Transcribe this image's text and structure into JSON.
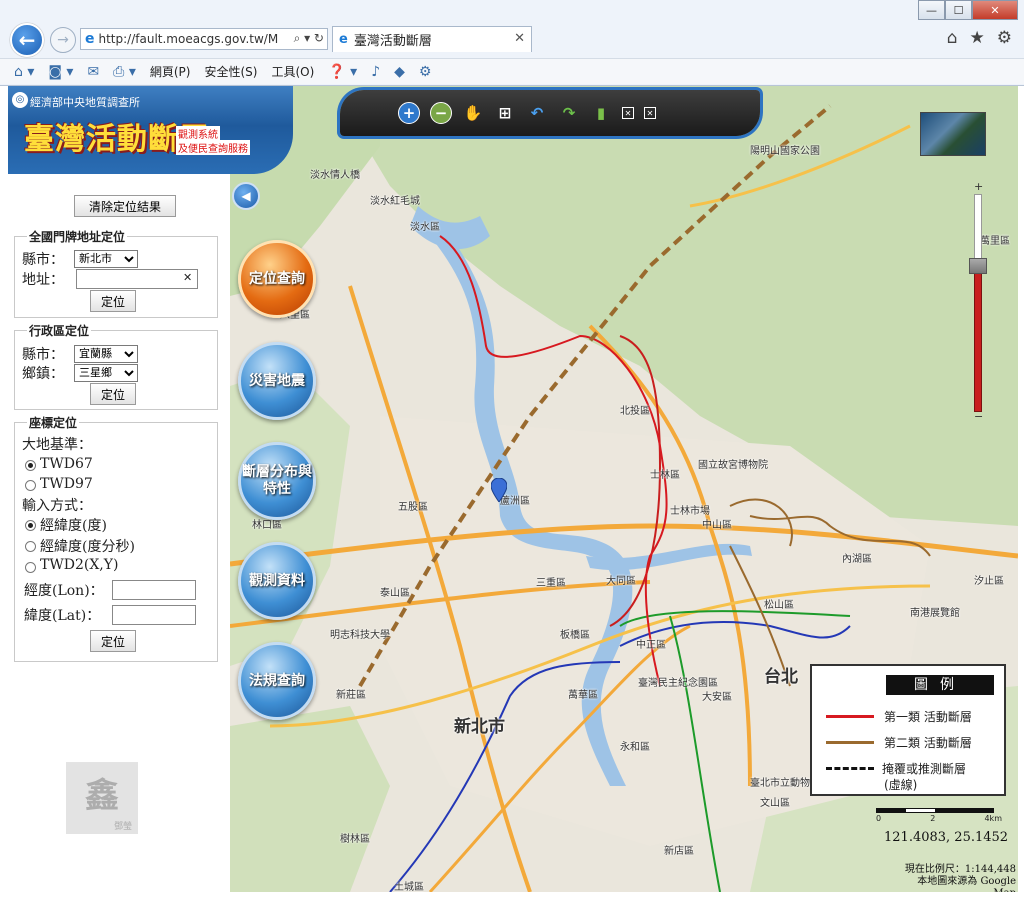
{
  "browser": {
    "url": "http://fault.moeacgs.gov.tw/M",
    "tab_title": "臺灣活動斷層",
    "menu": [
      "網頁(P)",
      "安全性(S)",
      "工具(O)"
    ],
    "titlebar": {
      "min": "—",
      "max": "☐",
      "close": "✕"
    }
  },
  "banner": {
    "org": "經濟部中央地質調查所",
    "title": "臺灣活動斷層",
    "sub1": "觀測系統",
    "sub2": "及便民查詢服務"
  },
  "panel": {
    "clear_label": "清除定位結果",
    "address_section": {
      "legend": "全國門牌地址定位",
      "county_label": "縣市：",
      "county_value": "新北市",
      "address_label": "地址：",
      "address_value": "",
      "locate_label": "定位"
    },
    "admin_section": {
      "legend": "行政區定位",
      "county_label": "縣市：",
      "county_value": "宜蘭縣",
      "town_label": "鄉鎮：",
      "town_value": "三星鄉",
      "locate_label": "定位"
    },
    "coord_section": {
      "legend": "座標定位",
      "datum_label": "大地基準：",
      "datum_options": [
        "TWD67",
        "TWD97"
      ],
      "input_label": "輸入方式：",
      "input_options": [
        "經緯度(度)",
        "經緯度(度分秒)",
        "TWD2(X,Y)"
      ],
      "lon_label": "經度(Lon)：",
      "lat_label": "緯度(Lat)：",
      "locate_label": "定位"
    },
    "seal_text": "鑫",
    "seal_sub": "鄧瑩"
  },
  "map": {
    "side_buttons": [
      "定位查詢",
      "災害地震",
      "斷層分布與特性",
      "觀測資料",
      "法規查詢"
    ],
    "legend": {
      "title": "圖例",
      "items": [
        {
          "label": "第一類 活動斷層",
          "color": "#d71920"
        },
        {
          "label": "第二類 活動斷層",
          "color": "#9a6a2e"
        },
        {
          "label": "掩覆或推測斷層",
          "sub": "(虛線)"
        }
      ]
    },
    "scale_ticks": [
      "0",
      "2",
      "4km"
    ],
    "coords": "121.4083, 25.1452",
    "scale_text": "現在比例尺：1:144,448",
    "source_text": "本地圖來源為 Google Map",
    "labels": [
      {
        "text": "淡水情人橋"
      },
      {
        "text": "淡水紅毛城"
      },
      {
        "text": "淡水區"
      },
      {
        "text": "八里區"
      },
      {
        "text": "北投區"
      },
      {
        "text": "士林區"
      },
      {
        "text": "國立故宮博物院"
      },
      {
        "text": "士林市場"
      },
      {
        "text": "中山區"
      },
      {
        "text": "內湖區"
      },
      {
        "text": "松山區"
      },
      {
        "text": "五股區"
      },
      {
        "text": "蘆洲區"
      },
      {
        "text": "林口區"
      },
      {
        "text": "三重區"
      },
      {
        "text": "大同區"
      },
      {
        "text": "泰山區"
      },
      {
        "text": "明志科技大學"
      },
      {
        "text": "新莊區"
      },
      {
        "text": "中正區"
      },
      {
        "text": "萬華區"
      },
      {
        "text": "臺灣民主紀念園區"
      },
      {
        "text": "大安區"
      },
      {
        "text": "永和區"
      },
      {
        "text": "新北市"
      },
      {
        "text": "台北"
      },
      {
        "text": "樹林區"
      },
      {
        "text": "土城區"
      },
      {
        "text": "新店區"
      },
      {
        "text": "文山區"
      },
      {
        "text": "汐止區"
      },
      {
        "text": "南港展覽館"
      },
      {
        "text": "陽明山國家公園"
      },
      {
        "text": "萬里區"
      },
      {
        "text": "臺北市立動物園"
      },
      {
        "text": "板橋區"
      }
    ]
  }
}
